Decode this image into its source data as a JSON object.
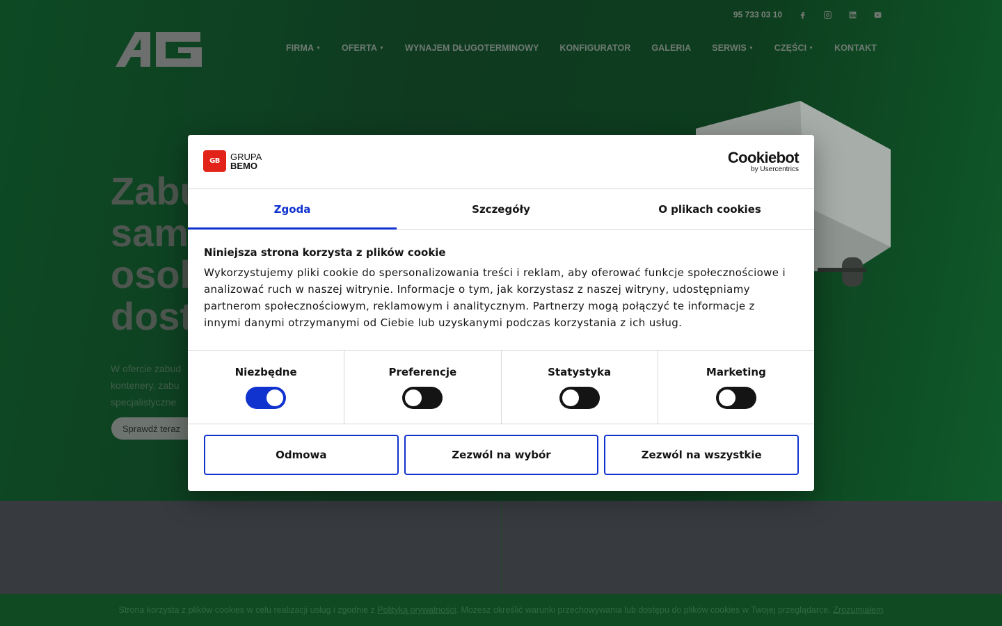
{
  "header": {
    "phone": "95 733 03 10",
    "social": [
      "facebook-icon",
      "instagram-icon",
      "linkedin-icon",
      "youtube-icon"
    ],
    "logo_text": "AG"
  },
  "nav": {
    "items": [
      {
        "label": "FIRMA",
        "dropdown": true
      },
      {
        "label": "OFERTA",
        "dropdown": true
      },
      {
        "label": "WYNAJEM DŁUGOTERMINOWY",
        "dropdown": false
      },
      {
        "label": "KONFIGURATOR",
        "dropdown": false
      },
      {
        "label": "GALERIA",
        "dropdown": false
      },
      {
        "label": "SERWIS",
        "dropdown": true
      },
      {
        "label": "CZĘŚCI",
        "dropdown": true
      },
      {
        "label": "KONTAKT",
        "dropdown": false
      }
    ]
  },
  "hero": {
    "title_lines": [
      "Zabu",
      "sam",
      "osob",
      "dost"
    ],
    "desc_lines": [
      "W ofercie zabud",
      "kontenery, zabu",
      "specjalistyczne"
    ],
    "cta": "Sprawdź teraz"
  },
  "dialog": {
    "brand_line1": "GRUPA",
    "brand_line2": "BEMO",
    "brand_mark": "GB",
    "cookiebot_title": "Cookiebot",
    "cookiebot_sub": "by Usercentrics",
    "tabs": [
      "Zgoda",
      "Szczegóły",
      "O plikach cookies"
    ],
    "active_tab": "Zgoda",
    "heading": "Niniejsza strona korzysta z plików cookie",
    "body_lines": [
      "Wykorzystujemy pliki cookie do spersonalizowania treści i reklam, aby oferować funkcje społecznościowe i",
      "analizować ruch w naszej witrynie. Informacje o tym, jak korzystasz z naszej witryny, udostępniamy",
      "partnerom społecznościowym, reklamowym i analitycznym. Partnerzy mogą połączyć te informacje z",
      "innymi danymi otrzymanymi od Ciebie lub uzyskanymi podczas korzystania z ich usług."
    ],
    "toggles": [
      {
        "label": "Niezbędne",
        "on": true
      },
      {
        "label": "Preferencje",
        "on": false
      },
      {
        "label": "Statystyka",
        "on": false
      },
      {
        "label": "Marketing",
        "on": false
      }
    ],
    "buttons": {
      "deny": "Odmowa",
      "allow_selection": "Zezwól na wybór",
      "allow_all": "Zezwól na wszystkie"
    },
    "accent_color": "#1032cf"
  },
  "cookie_bar": {
    "text_before": "Strona korzysta z plików cookies w celu realizacji usług i zgodnie z ",
    "policy_link": "Polityką prywatności",
    "text_after": ". Możesz określić warunki przechowywania lub dostępu do plików cookies w Twojej przeglądarce. ",
    "accept_link": "Zrozumiałem"
  }
}
